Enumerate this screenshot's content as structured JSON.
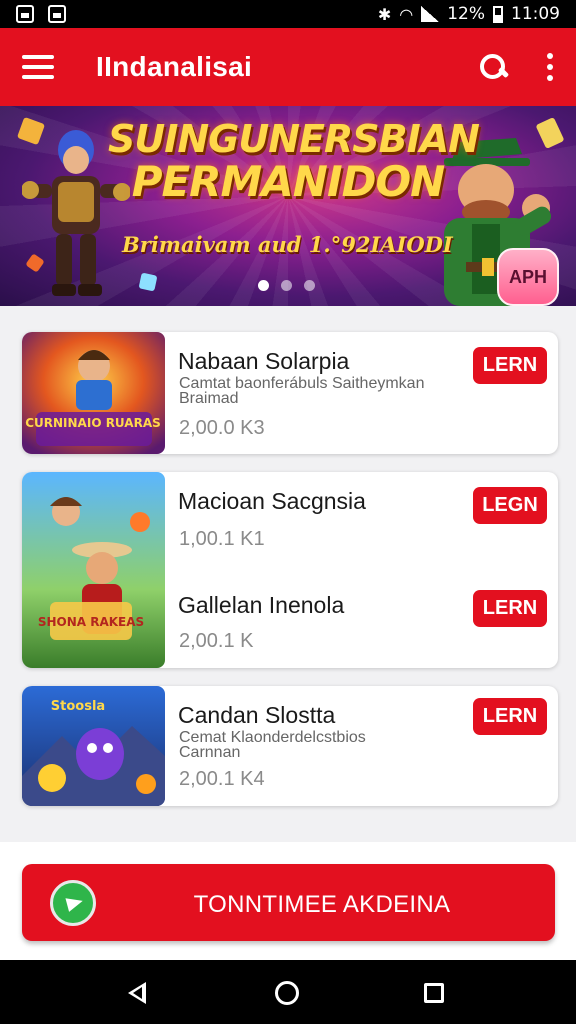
{
  "status_bar": {
    "battery": "12%",
    "time": "11:09",
    "icons": [
      "photo-icon",
      "image-icon",
      "bug-icon",
      "wifi-icon",
      "signal-icon",
      "battery-icon"
    ]
  },
  "app_bar": {
    "title": "IIndanalisai",
    "icons": [
      "menu-icon",
      "search-icon",
      "more-vert-icon"
    ]
  },
  "banner": {
    "headline_line1": "SUINGUNERSBIAN",
    "headline_line2": "PERMANIDON",
    "subtitle": "Brimaivam aud 1.°92IAIODI",
    "badge": "APH",
    "dots": 3,
    "active_dot": 0
  },
  "items": [
    {
      "title": "Nabaan Solarpia",
      "desc1": "Camtat  baonferábuls Saitheymkan",
      "desc2": "Braimad",
      "meta": "2,00.0 K3",
      "button": "LERN",
      "thumb_text": "CURNINAIO RUARAS"
    },
    {
      "title": "Macioan Sacgnsia",
      "desc1": "",
      "desc2": "",
      "meta": "1,00.1 K1",
      "button": "LEGN",
      "thumb_text": "SHONA RAKEAS"
    },
    {
      "title": "Gallelan Inenola",
      "desc1": "",
      "desc2": "",
      "meta": "2,00.1 K",
      "button": "LERN"
    },
    {
      "title": "Candan Slostta",
      "desc1": "Cemat  Klaonderdelcstbios",
      "desc2": "Carnnan",
      "meta": "2,00.1 K4",
      "button": "LERN",
      "thumb_text": "Stoosla"
    }
  ],
  "cta": {
    "label": "TONNTIMEE AKDEINA"
  },
  "colors": {
    "brand_red": "#e3101f",
    "status_bar": "#000000",
    "background": "#f1f1f3",
    "cta_icon_green": "#2fb54a"
  }
}
